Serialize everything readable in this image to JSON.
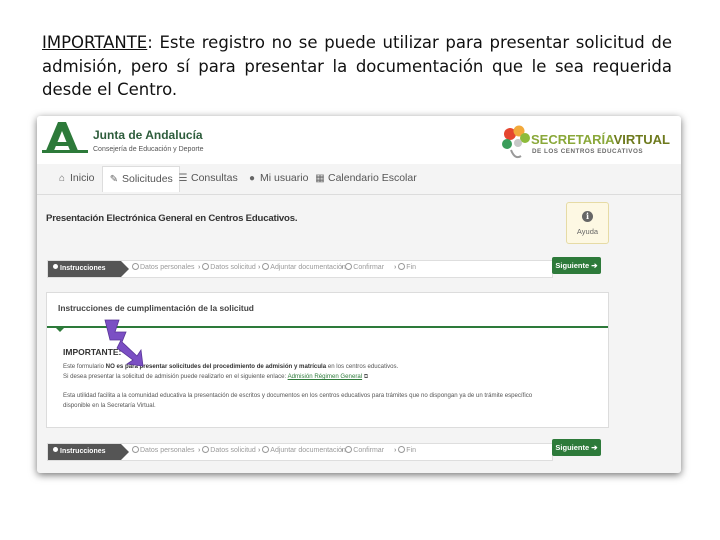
{
  "note": {
    "label": "IMPORTANTE",
    "text": ": Este registro no se puede utilizar para presentar solicitud de admisión, pero sí para presentar la documentación que le sea requerida desde el Centro."
  },
  "header": {
    "org_name": "Junta de Andalucía",
    "org_sub": "Consejería de Educación y Deporte",
    "sv_title_a": "SECRETARÍA",
    "sv_title_b": "VIRTUAL",
    "sv_sub": "DE LOS CENTROS EDUCATIVOS"
  },
  "nav": {
    "items": [
      {
        "label": "Inicio",
        "icon": "home-icon"
      },
      {
        "label": "Solicitudes",
        "icon": "pencil-icon"
      },
      {
        "label": "Consultas",
        "icon": "list-icon"
      },
      {
        "label": "Mi usuario",
        "icon": "user-icon"
      },
      {
        "label": "Calendario Escolar",
        "icon": "calendar-icon"
      }
    ]
  },
  "page": {
    "title": "Presentación Electrónica General en Centros Educativos.",
    "help_label": "Ayuda"
  },
  "steps": {
    "items": [
      "Instrucciones",
      "Datos personales",
      "Datos solicitud",
      "Adjuntar documentación",
      "Confirmar",
      "Fin"
    ],
    "next_label": "Siguiente"
  },
  "panel": {
    "title": "Instrucciones de cumplimentación de la solicitud",
    "important": "IMPORTANTE:",
    "line1_a": "Este formulario ",
    "line1_b": "NO es para presentar solicitudes del procedimiento de admisión y matrícula",
    "line1_c": " en los centros educativos.",
    "line2_a": "Si desea presentar la solicitud de admisión puede realizarlo en el siguiente enlace: ",
    "line2_link": "Admisión Régimen General",
    "line3": "Esta utilidad facilita a la comunidad educativa la presentación de escritos y documentos en los centros educativos para trámites que no dispongan ya de un trámite específico",
    "line4": "disponible en la Secretaría Virtual."
  },
  "colors": {
    "green": "#2d7a3a",
    "arrow": "#7b4fc4",
    "dark_step": "#555555"
  }
}
